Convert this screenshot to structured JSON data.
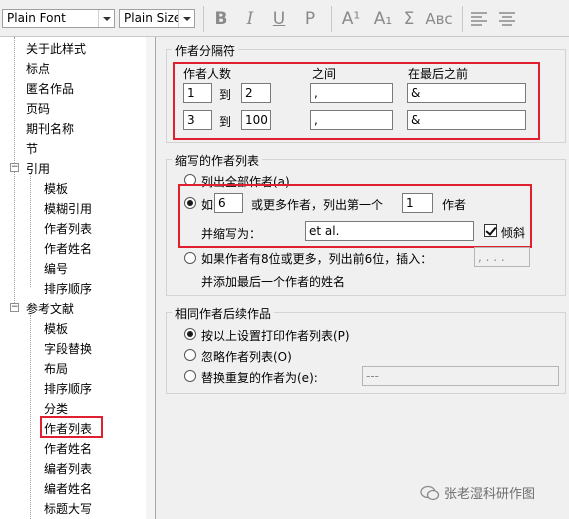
{
  "toolbar": {
    "font_value": "Plain Font",
    "size_value": "Plain Size",
    "bold": "B",
    "italic": "I",
    "underline": "U",
    "plain": "P",
    "superscript": "A¹",
    "subscript": "A₁",
    "symbol": "Σ",
    "smallcaps": "Aʙᴄ"
  },
  "tree": {
    "items": [
      "关于此样式",
      "标点",
      "匿名作品",
      "页码",
      "期刊名称",
      "节",
      "引用",
      "模板",
      "模糊引用",
      "作者列表",
      "作者姓名",
      "编号",
      "排序顺序",
      "参考文献",
      "模板",
      "字段替换",
      "布局",
      "排序顺序",
      "分类",
      "作者列表",
      "作者姓名",
      "编者列表",
      "编者姓名",
      "标题大写"
    ]
  },
  "separators": {
    "title": "作者分隔符",
    "col_count": "作者人数",
    "col_between": "之间",
    "col_before_last": "在最后之前",
    "to": "到",
    "rows": [
      {
        "from": "1",
        "to": "2",
        "between": ",",
        "before_last": "&"
      },
      {
        "from": "3",
        "to": "100",
        "between": ",",
        "before_last": "&"
      }
    ]
  },
  "abbrev": {
    "title": "缩写的作者列表",
    "list_all": "列出全部作者(a)",
    "if_label": "如(",
    "if_count": "6",
    "or_more_list_first": "或更多作者，列出第一个",
    "first_count": "1",
    "authors": "作者",
    "abbreviate_as": "并缩写为：",
    "abbrev_value": "et al.",
    "italic_label": "倾斜",
    "if8_text": "如果作者有8位或更多，列出前6位，插入：",
    "if8_value": ", . . .",
    "add_last": "并添加最后一个作者的姓名"
  },
  "subsequent": {
    "title": "相同作者后续作品",
    "opt_print": "按以上设置打印作者列表(P)",
    "opt_ignore": "忽略作者列表(O)",
    "opt_replace": "替换重复的作者为(e):",
    "replace_value": "---"
  },
  "watermark": "张老湿科研作图",
  "colors": {
    "highlight": "#e0202e"
  }
}
